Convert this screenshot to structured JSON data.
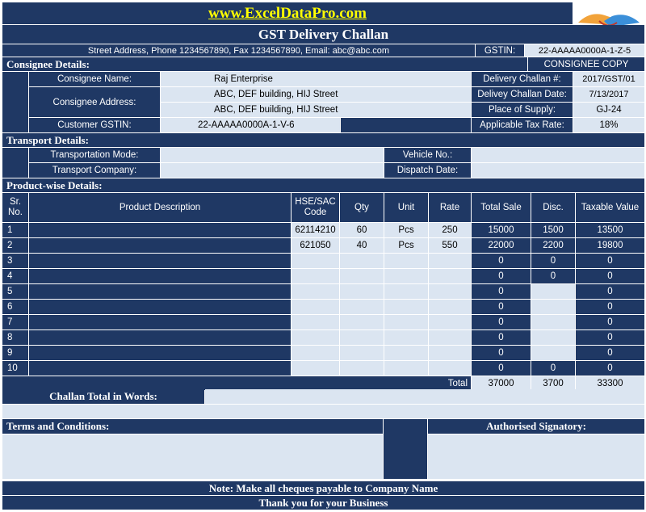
{
  "header": {
    "website": "www.ExcelDataPro.com",
    "title": "GST Delivery Challan",
    "address_line": "Street Address, Phone 1234567890, Fax 1234567890, Email: abc@abc.com",
    "gstin_label": "GSTIN:",
    "gstin_value": "22-AAAAA0000A-1-Z-5",
    "copy_label": "CONSIGNEE COPY",
    "logo_icon": "handshake-logo"
  },
  "consignee": {
    "section_title": "Consignee Details:",
    "name_label": "Consignee Name:",
    "name_value": "Raj Enterprise",
    "address_label": "Consignee Address:",
    "address_line1": "ABC, DEF building, HIJ Street",
    "address_line2": "ABC, DEF building, HIJ Street",
    "gstin_label": "Customer GSTIN:",
    "gstin_value": "22-AAAAA0000A-1-V-6",
    "challan_no_label": "Delivery Challan #:",
    "challan_no_value": "2017/GST/01",
    "challan_date_label": "Delivey Challan Date:",
    "challan_date_value": "7/13/2017",
    "place_label": "Place of Supply:",
    "place_value": "GJ-24",
    "tax_label": "Applicable Tax Rate:",
    "tax_value": "18%"
  },
  "transport": {
    "section_title": "Transport Details:",
    "mode_label": "Transportation Mode:",
    "mode_value": "",
    "company_label": "Transport Company:",
    "company_value": "",
    "vehicle_label": "Vehicle No.:",
    "vehicle_value": "",
    "dispatch_label": "Dispatch Date:",
    "dispatch_value": ""
  },
  "products": {
    "section_title": "Product-wise Details:",
    "columns": [
      "Sr. No.",
      "Product Description",
      "HSE/SAC Code",
      "Qty",
      "Unit",
      "Rate",
      "Total Sale",
      "Disc.",
      "Taxable Value"
    ],
    "rows": [
      {
        "sr": "1",
        "desc": "",
        "code": "62114210",
        "qty": "60",
        "unit": "Pcs",
        "rate": "250",
        "total": "15000",
        "disc": "1500",
        "taxable": "13500"
      },
      {
        "sr": "2",
        "desc": "",
        "code": "621050",
        "qty": "40",
        "unit": "Pcs",
        "rate": "550",
        "total": "22000",
        "disc": "2200",
        "taxable": "19800"
      },
      {
        "sr": "3",
        "desc": "",
        "code": "",
        "qty": "",
        "unit": "",
        "rate": "",
        "total": "0",
        "disc": "0",
        "taxable": "0"
      },
      {
        "sr": "4",
        "desc": "",
        "code": "",
        "qty": "",
        "unit": "",
        "rate": "",
        "total": "0",
        "disc": "0",
        "taxable": "0"
      },
      {
        "sr": "5",
        "desc": "",
        "code": "",
        "qty": "",
        "unit": "",
        "rate": "",
        "total": "0",
        "disc": "",
        "taxable": "0"
      },
      {
        "sr": "6",
        "desc": "",
        "code": "",
        "qty": "",
        "unit": "",
        "rate": "",
        "total": "0",
        "disc": "",
        "taxable": "0"
      },
      {
        "sr": "7",
        "desc": "",
        "code": "",
        "qty": "",
        "unit": "",
        "rate": "",
        "total": "0",
        "disc": "",
        "taxable": "0"
      },
      {
        "sr": "8",
        "desc": "",
        "code": "",
        "qty": "",
        "unit": "",
        "rate": "",
        "total": "0",
        "disc": "",
        "taxable": "0"
      },
      {
        "sr": "9",
        "desc": "",
        "code": "",
        "qty": "",
        "unit": "",
        "rate": "",
        "total": "0",
        "disc": "",
        "taxable": "0"
      },
      {
        "sr": "10",
        "desc": "",
        "code": "",
        "qty": "",
        "unit": "",
        "rate": "",
        "total": "0",
        "disc": "0",
        "taxable": "0"
      }
    ],
    "total_label": "Total",
    "total_sale": "37000",
    "total_disc": "3700",
    "total_taxable": "33300"
  },
  "footer": {
    "words_label": "Challan Total in Words:",
    "words_value": "",
    "terms_label": "Terms and Conditions:",
    "signatory_label": "Authorised Signatory:",
    "note": "Note: Make all cheques payable to Company Name",
    "thanks": "Thank you for your Business"
  },
  "colors": {
    "navy": "#1f3864",
    "light_blue": "#dbe5f1",
    "website_yellow": "#ffff00"
  }
}
